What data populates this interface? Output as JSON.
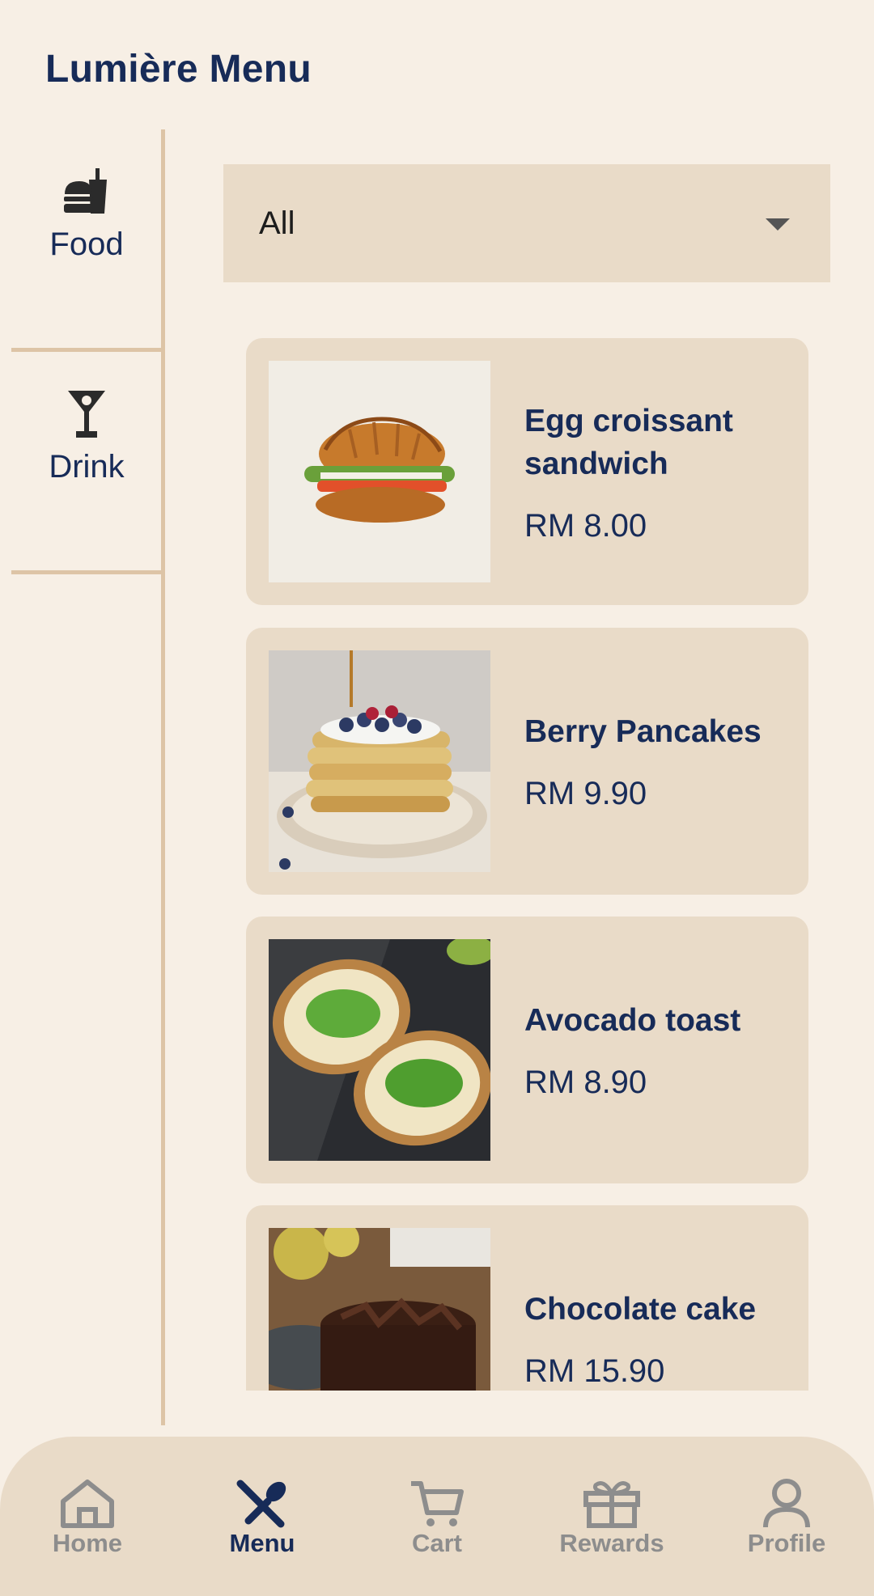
{
  "header": {
    "title": "Lumière Menu"
  },
  "categories": [
    {
      "label": "Food",
      "icon": "fast-food-icon"
    },
    {
      "label": "Drink",
      "icon": "cocktail-icon"
    }
  ],
  "filter": {
    "selected": "All"
  },
  "menu_items": [
    {
      "name": "Egg croissant sandwich",
      "price": "RM 8.00",
      "image": "croissant-sandwich-photo"
    },
    {
      "name": "Berry Pancakes",
      "price": "RM 9.90",
      "image": "berry-pancakes-photo"
    },
    {
      "name": "Avocado toast",
      "price": "RM 8.90",
      "image": "avocado-toast-photo"
    },
    {
      "name": "Chocolate cake",
      "price": "RM 15.90",
      "image": "chocolate-cake-photo"
    }
  ],
  "bottom_nav": {
    "items": [
      {
        "label": "Home",
        "icon": "home-icon",
        "active": false
      },
      {
        "label": "Menu",
        "icon": "utensils-icon",
        "active": true
      },
      {
        "label": "Cart",
        "icon": "cart-icon",
        "active": false
      },
      {
        "label": "Rewards",
        "icon": "gift-icon",
        "active": false
      },
      {
        "label": "Profile",
        "icon": "person-icon",
        "active": false
      }
    ]
  },
  "colors": {
    "background": "#f7efe5",
    "card": "#e9dbc8",
    "accent_navy": "#172b58",
    "divider": "#ddc4a6",
    "inactive_nav": "#8d8d8d"
  }
}
